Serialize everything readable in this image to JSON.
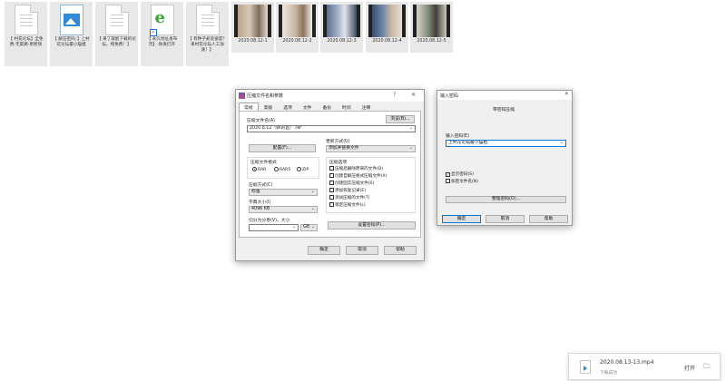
{
  "desktop": {
    "files": [
      {
        "name": "【 村花论坛】全免费-无套路-更新快",
        "icon": "text-doc"
      },
      {
        "name": "【 解压密码：】上村花论坛最小猫姐",
        "icon": "image"
      },
      {
        "name": "【 来了就能下载的论坛，纯免费！】",
        "icon": "text-doc"
      },
      {
        "name": "【 永久地址发布页】-防丢打开",
        "icon": "ie-link"
      },
      {
        "name": "【 有种子却没速度？来村花论坛人工加速！】",
        "icon": "text-doc"
      }
    ],
    "videos": [
      {
        "name": "2020.08.12-1"
      },
      {
        "name": "2020.08.12-2"
      },
      {
        "name": "2020.08.12-3"
      },
      {
        "name": "2020.08.12-4"
      },
      {
        "name": "2020.08.12-5"
      }
    ]
  },
  "archive_dialog": {
    "title": "压缩文件名和参数",
    "help": "?",
    "close": "✕",
    "tabs": [
      "常规",
      "高级",
      "选项",
      "文件",
      "备份",
      "时间",
      "注释"
    ],
    "archive_name_label": "压缩文件名(A)",
    "browse": "浏览(B)...",
    "archive_name_value": "2020.8.12（wi的首）.rar",
    "profiles": "配置(F)...",
    "update_mode_label": "更新方式(U)",
    "update_mode_value": "添加并替换文件",
    "format_label": "压缩文件格式",
    "formats": [
      "RAR",
      "RAR5",
      "ZIP"
    ],
    "method_label": "压缩方式(C)",
    "method_value": "标准",
    "dict_label": "字典大小(I)",
    "dict_value": "4096 KB",
    "split_label": "切分为分卷(V)，大小",
    "split_value": "",
    "split_unit": "GB",
    "options_label": "压缩选项",
    "options": [
      "压缩后删除原来的文件(D)",
      "创建自解压格式压缩文件(X)",
      "创建固实压缩文件(S)",
      "添加恢复记录(E)",
      "测试压缩的文件(T)",
      "锁定压缩文件(L)"
    ],
    "set_password": "设置密码(P)...",
    "ok": "确定",
    "cancel": "取消",
    "help_btn": "帮助"
  },
  "password_dialog": {
    "title": "输入密码",
    "close": "✕",
    "heading": "带密码压缩",
    "pw_label": "输入密码(E)",
    "pw_value": "上村花论坛最小猫姐",
    "show_pw": "显示密码(S)",
    "encrypt_names": "加密文件名(N)",
    "organize": "整理密码(O)...",
    "ok": "确定",
    "cancel": "取消",
    "help": "帮助"
  },
  "download": {
    "filename": "2020.08.13-13.mp4",
    "status": "下载成功",
    "open": "打开",
    "folder_icon": "folder-icon"
  }
}
